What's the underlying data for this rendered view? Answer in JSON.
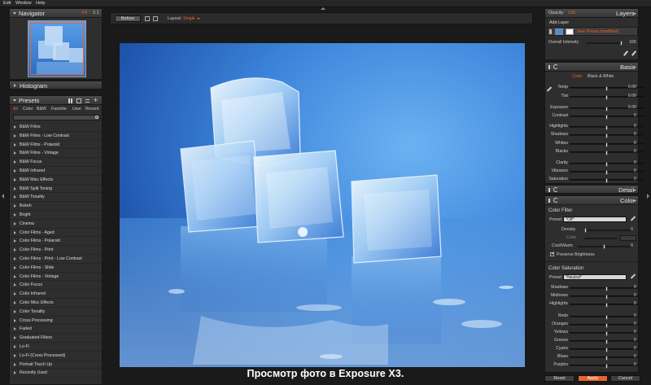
{
  "menu": {
    "items": [
      "Edit",
      "Window",
      "Help"
    ]
  },
  "navigator": {
    "title": "Navigator",
    "zoom_fit": "Fit",
    "zoom_11": "1:1"
  },
  "histogram": {
    "title": "Histogram"
  },
  "presets": {
    "title": "Presets",
    "tabs": [
      "All",
      "Color",
      "B&W",
      "Favorite",
      "User",
      "Recent"
    ],
    "items": [
      "B&W Films",
      "B&W Films - Low Contrast",
      "B&W Films - Polaroid",
      "B&W Films - Vintage",
      "B&W Focus",
      "B&W Infrared",
      "B&W Misc Effects",
      "B&W Split Toning",
      "B&W Tonality",
      "Bokeh",
      "Bright",
      "Cinema",
      "Color Films - Aged",
      "Color Films - Polaroid",
      "Color Films - Print",
      "Color Films - Print - Low Contrast",
      "Color Films - Slide",
      "Color Films - Vintage",
      "Color Focus",
      "Color Infrared",
      "Color Misc Effects",
      "Color Tonality",
      "Cross Processing",
      "Faded",
      "Graduated Filters",
      "Lo-Fi",
      "Lo-Fi (Cross Processed)",
      "Portrait Touch Up",
      "Recently Used"
    ]
  },
  "toolbar": {
    "before_label": "Before",
    "layout_label": "Layout:",
    "layout_value": "Single"
  },
  "layers": {
    "opacity_label": "Opacity:",
    "opacity_value": "100",
    "title": "Layers",
    "add_layer": "Add Layer",
    "layer_name": "New Preset (modified)",
    "overall_label": "Overall Intensity",
    "overall_value": "100"
  },
  "basic": {
    "title": "Basic",
    "mode_color": "Color",
    "mode_bw": "Black & White",
    "sliders": [
      {
        "label": "Temp",
        "value": "0.00",
        "pos": 0.5
      },
      {
        "label": "Tint",
        "value": "0.00",
        "pos": 0.5
      },
      {
        "label": "Exposure",
        "value": "0.00",
        "pos": 0.5
      },
      {
        "label": "Contrast",
        "value": "0",
        "pos": 0.5
      },
      {
        "label": "Highlights",
        "value": "0",
        "pos": 0.5
      },
      {
        "label": "Shadows",
        "value": "0",
        "pos": 0.5
      },
      {
        "label": "Whites",
        "value": "0",
        "pos": 0.5
      },
      {
        "label": "Blacks",
        "value": "0",
        "pos": 0.5
      },
      {
        "label": "Clarity",
        "value": "0",
        "pos": 0.5
      },
      {
        "label": "Vibrance",
        "value": "0",
        "pos": 0.5
      },
      {
        "label": "Saturation",
        "value": "0",
        "pos": 0.5
      }
    ]
  },
  "detail": {
    "title": "Detail"
  },
  "color": {
    "title": "Color",
    "filter_title": "Color Filter",
    "preset_label": "Preset:",
    "filter_preset": "*Off*",
    "density_label": "Density",
    "density_value": "0",
    "color_label": "Color",
    "coolwarm_label": "Cool/Warm",
    "coolwarm_value": "0",
    "preserve_label": "Preserve Brightness",
    "saturation_title": "Color Saturation",
    "sat_preset": "*Neutral*",
    "sat_sliders": [
      {
        "label": "Shadows",
        "value": "0",
        "pos": 0.5
      },
      {
        "label": "Midtones",
        "value": "0",
        "pos": 0.5
      },
      {
        "label": "Highlights",
        "value": "0",
        "pos": 0.5
      },
      {
        "label": "Reds",
        "value": "0",
        "pos": 0.5
      },
      {
        "label": "Oranges",
        "value": "0",
        "pos": 0.5
      },
      {
        "label": "Yellows",
        "value": "0",
        "pos": 0.5
      },
      {
        "label": "Greens",
        "value": "0",
        "pos": 0.5
      },
      {
        "label": "Cyans",
        "value": "0",
        "pos": 0.5
      },
      {
        "label": "Blues",
        "value": "0",
        "pos": 0.5
      },
      {
        "label": "Purples",
        "value": "0",
        "pos": 0.5
      }
    ]
  },
  "footer": {
    "reset": "Reset",
    "apply": "Apply",
    "cancel": "Cancel"
  },
  "caption": "Просмотр фото в Exposure X3.",
  "colors": {
    "accent": "#e8642a",
    "bg": "#1a1a1a",
    "panel": "#2e2e2e"
  }
}
